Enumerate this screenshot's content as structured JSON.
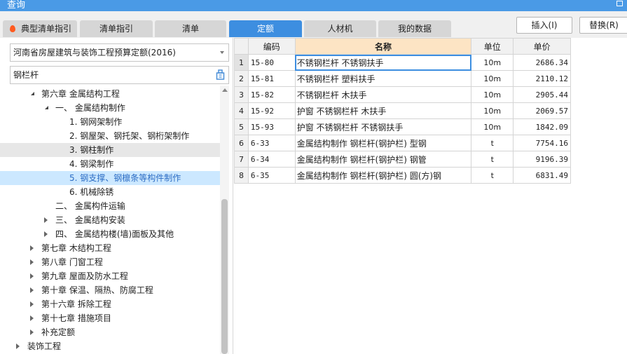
{
  "window": {
    "title": "查询"
  },
  "tabs": [
    {
      "label": "典型清单指引",
      "active": false
    },
    {
      "label": "清单指引",
      "active": false
    },
    {
      "label": "清单",
      "active": false
    },
    {
      "label": "定额",
      "active": true
    },
    {
      "label": "人材机",
      "active": false
    },
    {
      "label": "我的数据",
      "active": false
    }
  ],
  "actions": {
    "insert": "插入(I)",
    "replace": "替换(R)"
  },
  "left": {
    "library_select": "河南省房屋建筑与装饰工程预算定额(2016)",
    "search_value": "钢栏杆"
  },
  "tree": [
    {
      "label": "第六章 金属结构工程",
      "toggle": "expanded",
      "state": ""
    },
    {
      "label": "一、 金属结构制作",
      "toggle": "expanded",
      "state": ""
    },
    {
      "label": "1. 钢网架制作",
      "toggle": "",
      "state": ""
    },
    {
      "label": "2. 钢屋架、钢托架、钢桁架制作",
      "toggle": "",
      "state": ""
    },
    {
      "label": "3. 钢柱制作",
      "toggle": "",
      "state": "hover"
    },
    {
      "label": "4. 钢梁制作",
      "toggle": "",
      "state": ""
    },
    {
      "label": "5. 钢支撑、钢檩条等构件制作",
      "toggle": "",
      "state": "selected"
    },
    {
      "label": "6. 机械除锈",
      "toggle": "",
      "state": ""
    },
    {
      "label": "二、 金属构件运输",
      "toggle": "",
      "state": ""
    },
    {
      "label": "三、 金属结构安装",
      "toggle": "collapsed",
      "state": ""
    },
    {
      "label": "四、 金属结构楼(墙)面板及其他",
      "toggle": "collapsed",
      "state": ""
    },
    {
      "label": "第七章 木结构工程",
      "toggle": "collapsed",
      "state": ""
    },
    {
      "label": "第八章 门窗工程",
      "toggle": "collapsed",
      "state": ""
    },
    {
      "label": "第九章 屋面及防水工程",
      "toggle": "collapsed",
      "state": ""
    },
    {
      "label": "第十章 保温、隔热、防腐工程",
      "toggle": "collapsed",
      "state": ""
    },
    {
      "label": "第十六章 拆除工程",
      "toggle": "collapsed",
      "state": ""
    },
    {
      "label": "第十七章 措施项目",
      "toggle": "collapsed",
      "state": ""
    },
    {
      "label": "补充定额",
      "toggle": "collapsed",
      "state": ""
    },
    {
      "label": "装饰工程",
      "toggle": "collapsed",
      "state": ""
    }
  ],
  "grid": {
    "headers": {
      "code": "编码",
      "name": "名称",
      "unit": "单位",
      "price": "单价"
    },
    "rows": [
      {
        "idx": "1",
        "code": "15-80",
        "name": "不锈钢栏杆 不锈钢扶手",
        "unit": "10m",
        "price": "2686.34"
      },
      {
        "idx": "2",
        "code": "15-81",
        "name": "不锈钢栏杆 塑料扶手",
        "unit": "10m",
        "price": "2110.12"
      },
      {
        "idx": "3",
        "code": "15-82",
        "name": "不锈钢栏杆 木扶手",
        "unit": "10m",
        "price": "2905.44"
      },
      {
        "idx": "4",
        "code": "15-92",
        "name": "护窗 不锈钢栏杆 木扶手",
        "unit": "10m",
        "price": "2069.57"
      },
      {
        "idx": "5",
        "code": "15-93",
        "name": "护窗 不锈钢栏杆 不锈钢扶手",
        "unit": "10m",
        "price": "1842.09"
      },
      {
        "idx": "6",
        "code": "6-33",
        "name": "金属结构制作 钢栏杆(钢护栏) 型钢",
        "unit": "t",
        "price": "7754.16"
      },
      {
        "idx": "7",
        "code": "6-34",
        "name": "金属结构制作 钢栏杆(钢护栏) 钢管",
        "unit": "t",
        "price": "9196.39"
      },
      {
        "idx": "8",
        "code": "6-35",
        "name": "金属结构制作 钢栏杆(钢护栏) 圆(方)钢",
        "unit": "t",
        "price": "6831.49"
      }
    ]
  },
  "colors": {
    "accent": "#3d8ee0",
    "titlebar": "#4a9ae6",
    "selected_bg": "#cce8ff",
    "name_header_bg": "#fde4c4"
  }
}
